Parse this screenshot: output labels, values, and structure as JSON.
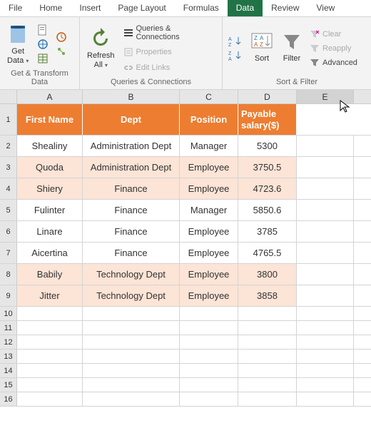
{
  "tabs": [
    "File",
    "Home",
    "Insert",
    "Page Layout",
    "Formulas",
    "Data",
    "Review",
    "View"
  ],
  "active_tab": "Data",
  "ribbon": {
    "get_transform": {
      "get_data": "Get\nData",
      "label": "Get & Transform Data"
    },
    "queries": {
      "refresh_all": "Refresh\nAll",
      "queries_connections": "Queries & Connections",
      "properties": "Properties",
      "edit_links": "Edit Links",
      "label": "Queries & Connections"
    },
    "sortfilter": {
      "sort": "Sort",
      "filter": "Filter",
      "clear": "Clear",
      "reapply": "Reapply",
      "advanced": "Advanced",
      "label": "Sort & Filter"
    }
  },
  "columns": [
    "A",
    "B",
    "C",
    "D",
    "E"
  ],
  "headers": [
    "First Name",
    "Dept",
    "Position",
    "Payable salary($)"
  ],
  "rows": [
    {
      "first": "Shealiny",
      "dept": "Administration Dept",
      "pos": "Manager",
      "sal": "5300",
      "shade": false
    },
    {
      "first": "Quoda",
      "dept": "Administration Dept",
      "pos": "Employee",
      "sal": "3750.5",
      "shade": true
    },
    {
      "first": "Shiery",
      "dept": "Finance",
      "pos": "Employee",
      "sal": "4723.6",
      "shade": true
    },
    {
      "first": "Fulinter",
      "dept": "Finance",
      "pos": "Manager",
      "sal": "5850.6",
      "shade": false
    },
    {
      "first": "Linare",
      "dept": "Finance",
      "pos": "Employee",
      "sal": "3785",
      "shade": false
    },
    {
      "first": "Aicertina",
      "dept": "Finance",
      "pos": "Employee",
      "sal": "4765.5",
      "shade": false
    },
    {
      "first": "Babily",
      "dept": "Technology Dept",
      "pos": "Employee",
      "sal": "3800",
      "shade": true
    },
    {
      "first": "Jitter",
      "dept": "Technology Dept",
      "pos": "Employee",
      "sal": "3858",
      "shade": true
    }
  ],
  "empty_rows": [
    10,
    11,
    12,
    13,
    14,
    15,
    16
  ]
}
